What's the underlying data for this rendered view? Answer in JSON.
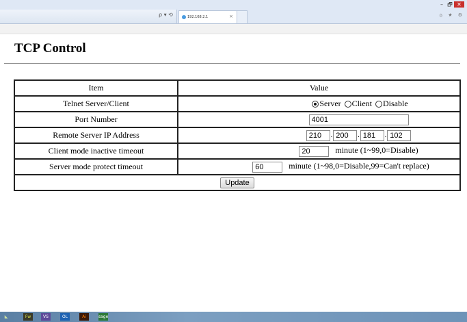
{
  "browser": {
    "tab_title": "192.168.2.1",
    "tab_close": "×",
    "addr_icons": "ρ ▾ ⟲",
    "window_buttons": {
      "minimize": "–",
      "restore": "🗗",
      "close": "✕"
    },
    "toolbar_icons": "⌂ ★ ⚙"
  },
  "page": {
    "title": "TCP Control"
  },
  "table": {
    "headers": {
      "item": "Item",
      "value": "Value"
    },
    "rows": {
      "telnet": {
        "label": "Telnet Server/Client",
        "options": [
          {
            "label": "Server",
            "selected": true
          },
          {
            "label": "Client",
            "selected": false
          },
          {
            "label": "Disable",
            "selected": false
          }
        ]
      },
      "port": {
        "label": "Port Number",
        "value": "4001"
      },
      "remote_ip": {
        "label": "Remote Server IP Address",
        "octets": [
          "210",
          "200",
          "181",
          "102"
        ]
      },
      "client_timeout": {
        "label": "Client mode inactive timeout",
        "value": "20",
        "hint": "minute (1~99,0=Disable)"
      },
      "server_timeout": {
        "label": "Server mode protect timeout",
        "value": "60",
        "hint": "minute (1~98,0=Disable,99=Can't replace)"
      }
    },
    "update_label": "Update"
  },
  "taskbar": {
    "items": [
      "Fw",
      "VS",
      "OL",
      "Ai",
      "sage"
    ]
  },
  "colors": {
    "close_red": "#c9302c",
    "taskbar": "#6e93b8",
    "chrome": "#dfe8f5"
  }
}
